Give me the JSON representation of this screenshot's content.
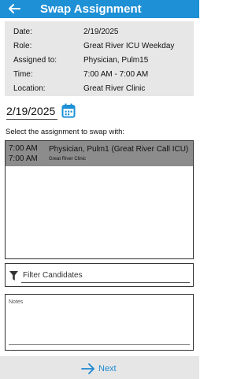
{
  "header": {
    "title": "Swap Assignment",
    "back_icon": "arrow-left-icon"
  },
  "assignment": {
    "rows": [
      {
        "label": "Date:",
        "value": "2/19/2025"
      },
      {
        "label": "Role:",
        "value": "Great River ICU Weekday"
      },
      {
        "label": "Assigned to:",
        "value": "Physician, Pulm15"
      },
      {
        "label": "Time:",
        "value": "7:00 AM - 7:00 AM"
      },
      {
        "label": "Location:",
        "value": "Great River Clinic"
      }
    ]
  },
  "date_picker": {
    "value": "2/19/2025",
    "icon": "calendar-icon"
  },
  "swap_list": {
    "prompt": "Select the assignment to swap with:",
    "items": [
      {
        "start": "7:00 AM",
        "end": "7:00 AM",
        "name": "Physician, Pulm1 (Great River Call ICU)",
        "location": "Great River Clinic",
        "selected": true
      }
    ]
  },
  "filter": {
    "placeholder": "Filter Candidates",
    "icon": "filter-icon"
  },
  "notes": {
    "placeholder": "Notes"
  },
  "footer": {
    "next_label": "Next",
    "icon": "arrow-right-icon"
  },
  "colors": {
    "accent": "#1e90d6",
    "selected_row": "#8c8c8c",
    "info_panel": "#e7e7e7",
    "footer": "#e6e6e6"
  }
}
